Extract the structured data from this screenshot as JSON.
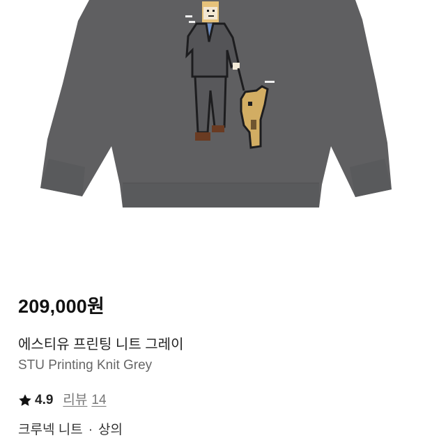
{
  "product": {
    "price": "209,000원",
    "name_ko": "에스티유 프린팅 니트 그레이",
    "name_en": "STU Printing Knit Grey",
    "rating": "4.9",
    "reviews_label": "리뷰",
    "reviews_count": "14",
    "category_1": "크루넥 니트",
    "category_sep": "·",
    "category_2": "상의"
  },
  "icons": {
    "rating": "star-icon",
    "image": "knit-sweater-product-image"
  },
  "colors": {
    "sweater": "#5f5f61",
    "text": "#111111",
    "subtext": "#666666"
  }
}
